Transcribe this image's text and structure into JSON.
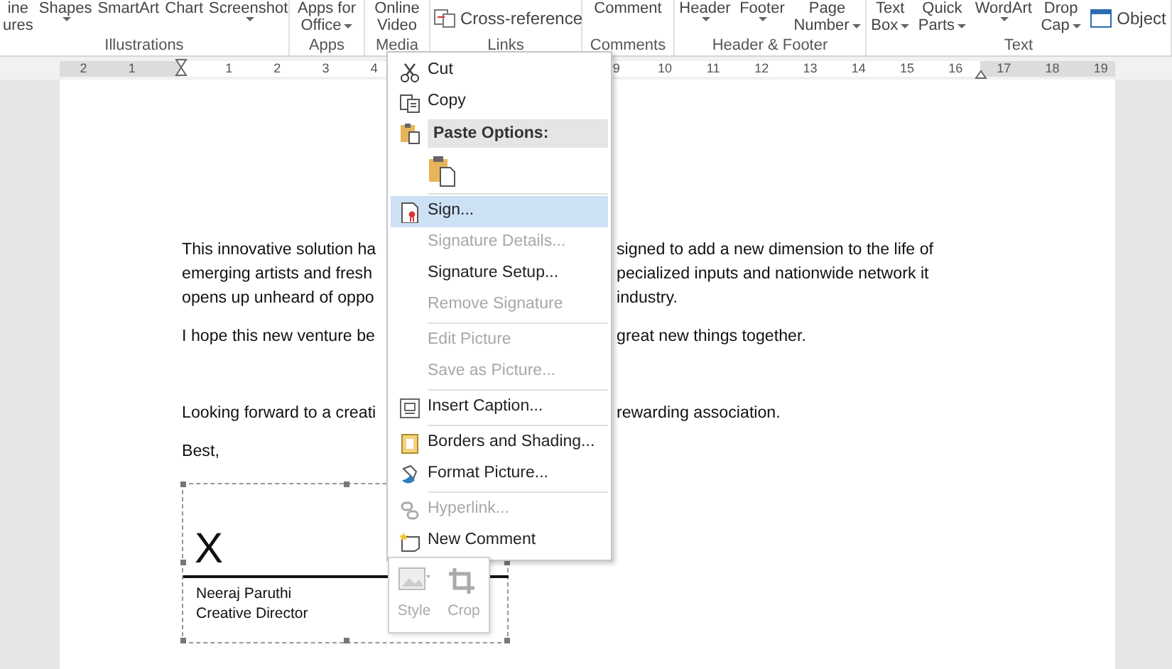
{
  "ribbon": {
    "groups": [
      {
        "label": "Illustrations",
        "buttons": [
          {
            "lines": [
              "ine",
              "ures"
            ],
            "dropdown": false
          },
          {
            "lines": [
              "Shapes"
            ],
            "dropdown": true
          },
          {
            "lines": [
              "SmartArt"
            ],
            "dropdown": false
          },
          {
            "lines": [
              "Chart"
            ],
            "dropdown": false
          },
          {
            "lines": [
              "Screenshot"
            ],
            "dropdown": true
          }
        ]
      },
      {
        "label": "Apps",
        "buttons": [
          {
            "lines": [
              "Apps for",
              "Office"
            ],
            "dropdown": true
          }
        ]
      },
      {
        "label": "Media",
        "buttons": [
          {
            "lines": [
              "Online",
              "Video"
            ],
            "dropdown": false
          }
        ]
      },
      {
        "label": "Links",
        "buttons": [
          {
            "lines": [
              "Cross-reference"
            ],
            "dropdown": false,
            "kind": "small"
          }
        ]
      },
      {
        "label": "Comments",
        "buttons": [
          {
            "lines": [
              "Comment"
            ],
            "dropdown": false
          }
        ]
      },
      {
        "label": "Header & Footer",
        "buttons": [
          {
            "lines": [
              "Header"
            ],
            "dropdown": true
          },
          {
            "lines": [
              "Footer"
            ],
            "dropdown": true
          },
          {
            "lines": [
              "Page",
              "Number"
            ],
            "dropdown": true
          }
        ]
      },
      {
        "label": "Text",
        "buttons": [
          {
            "lines": [
              "Text",
              "Box"
            ],
            "dropdown": true
          },
          {
            "lines": [
              "Quick",
              "Parts"
            ],
            "dropdown": true
          },
          {
            "lines": [
              "WordArt"
            ],
            "dropdown": true
          },
          {
            "lines": [
              "Drop",
              "Cap"
            ],
            "dropdown": true
          },
          {
            "lines": [
              "Object"
            ],
            "dropdown": false,
            "kind": "small"
          }
        ]
      }
    ]
  },
  "ruler": {
    "left_marks": [
      "2",
      "1"
    ],
    "marks_before_menu": [
      "1",
      "2",
      "3",
      "4"
    ],
    "marks_after_menu": [
      "9",
      "10",
      "11",
      "12",
      "13",
      "14",
      "15",
      "16",
      "17",
      "18",
      "19"
    ]
  },
  "document": {
    "paragraphs": [
      {
        "lines": [
          {
            "left": "This innovative solution ha",
            "right": "signed to add a new dimension to the life of"
          },
          {
            "left": "emerging artists and fresh",
            "right": "pecialized inputs and nationwide network it"
          },
          {
            "left": "opens up unheard of oppo",
            "right": "industry."
          }
        ]
      },
      {
        "lines": [
          {
            "left": "I hope this new venture be",
            "right": "great new things together."
          }
        ]
      },
      {
        "lines": [
          {
            "left": "Looking forward to a creati",
            "right": "rewarding association."
          }
        ]
      },
      {
        "lines": [
          {
            "left": "Best,"
          }
        ]
      }
    ],
    "signature_line": {
      "mark": "X",
      "signer_name": "Neeraj Paruthi",
      "signer_title": "Creative Director"
    }
  },
  "context_menu": {
    "items": [
      {
        "kind": "command",
        "label": "Cut",
        "disabled": false,
        "selected": false
      },
      {
        "kind": "command",
        "label": "Copy",
        "disabled": false,
        "selected": false
      },
      {
        "kind": "header",
        "label": "Paste Options:"
      },
      {
        "kind": "paste_row"
      },
      {
        "kind": "separator"
      },
      {
        "kind": "command",
        "label": "Sign...",
        "disabled": false,
        "selected": true
      },
      {
        "kind": "command",
        "label": "Signature Details...",
        "disabled": true,
        "selected": false
      },
      {
        "kind": "command",
        "label": "Signature Setup...",
        "disabled": false,
        "selected": false
      },
      {
        "kind": "command",
        "label": "Remove Signature",
        "disabled": true,
        "selected": false
      },
      {
        "kind": "separator"
      },
      {
        "kind": "command",
        "label": "Edit Picture",
        "disabled": true,
        "selected": false
      },
      {
        "kind": "command",
        "label": "Save as Picture...",
        "disabled": true,
        "selected": false
      },
      {
        "kind": "separator"
      },
      {
        "kind": "command",
        "label": "Insert Caption...",
        "disabled": false,
        "selected": false
      },
      {
        "kind": "separator"
      },
      {
        "kind": "command",
        "label": "Borders and Shading...",
        "disabled": false,
        "selected": false
      },
      {
        "kind": "command",
        "label": "Format Picture...",
        "disabled": false,
        "selected": false
      },
      {
        "kind": "separator"
      },
      {
        "kind": "command",
        "label": "Hyperlink...",
        "disabled": true,
        "selected": false
      },
      {
        "kind": "command",
        "label": "New Comment",
        "disabled": false,
        "selected": false
      }
    ]
  },
  "mini_toolbar": {
    "buttons": [
      {
        "label": "Style",
        "disabled": true
      },
      {
        "label": "Crop",
        "disabled": true
      }
    ]
  }
}
